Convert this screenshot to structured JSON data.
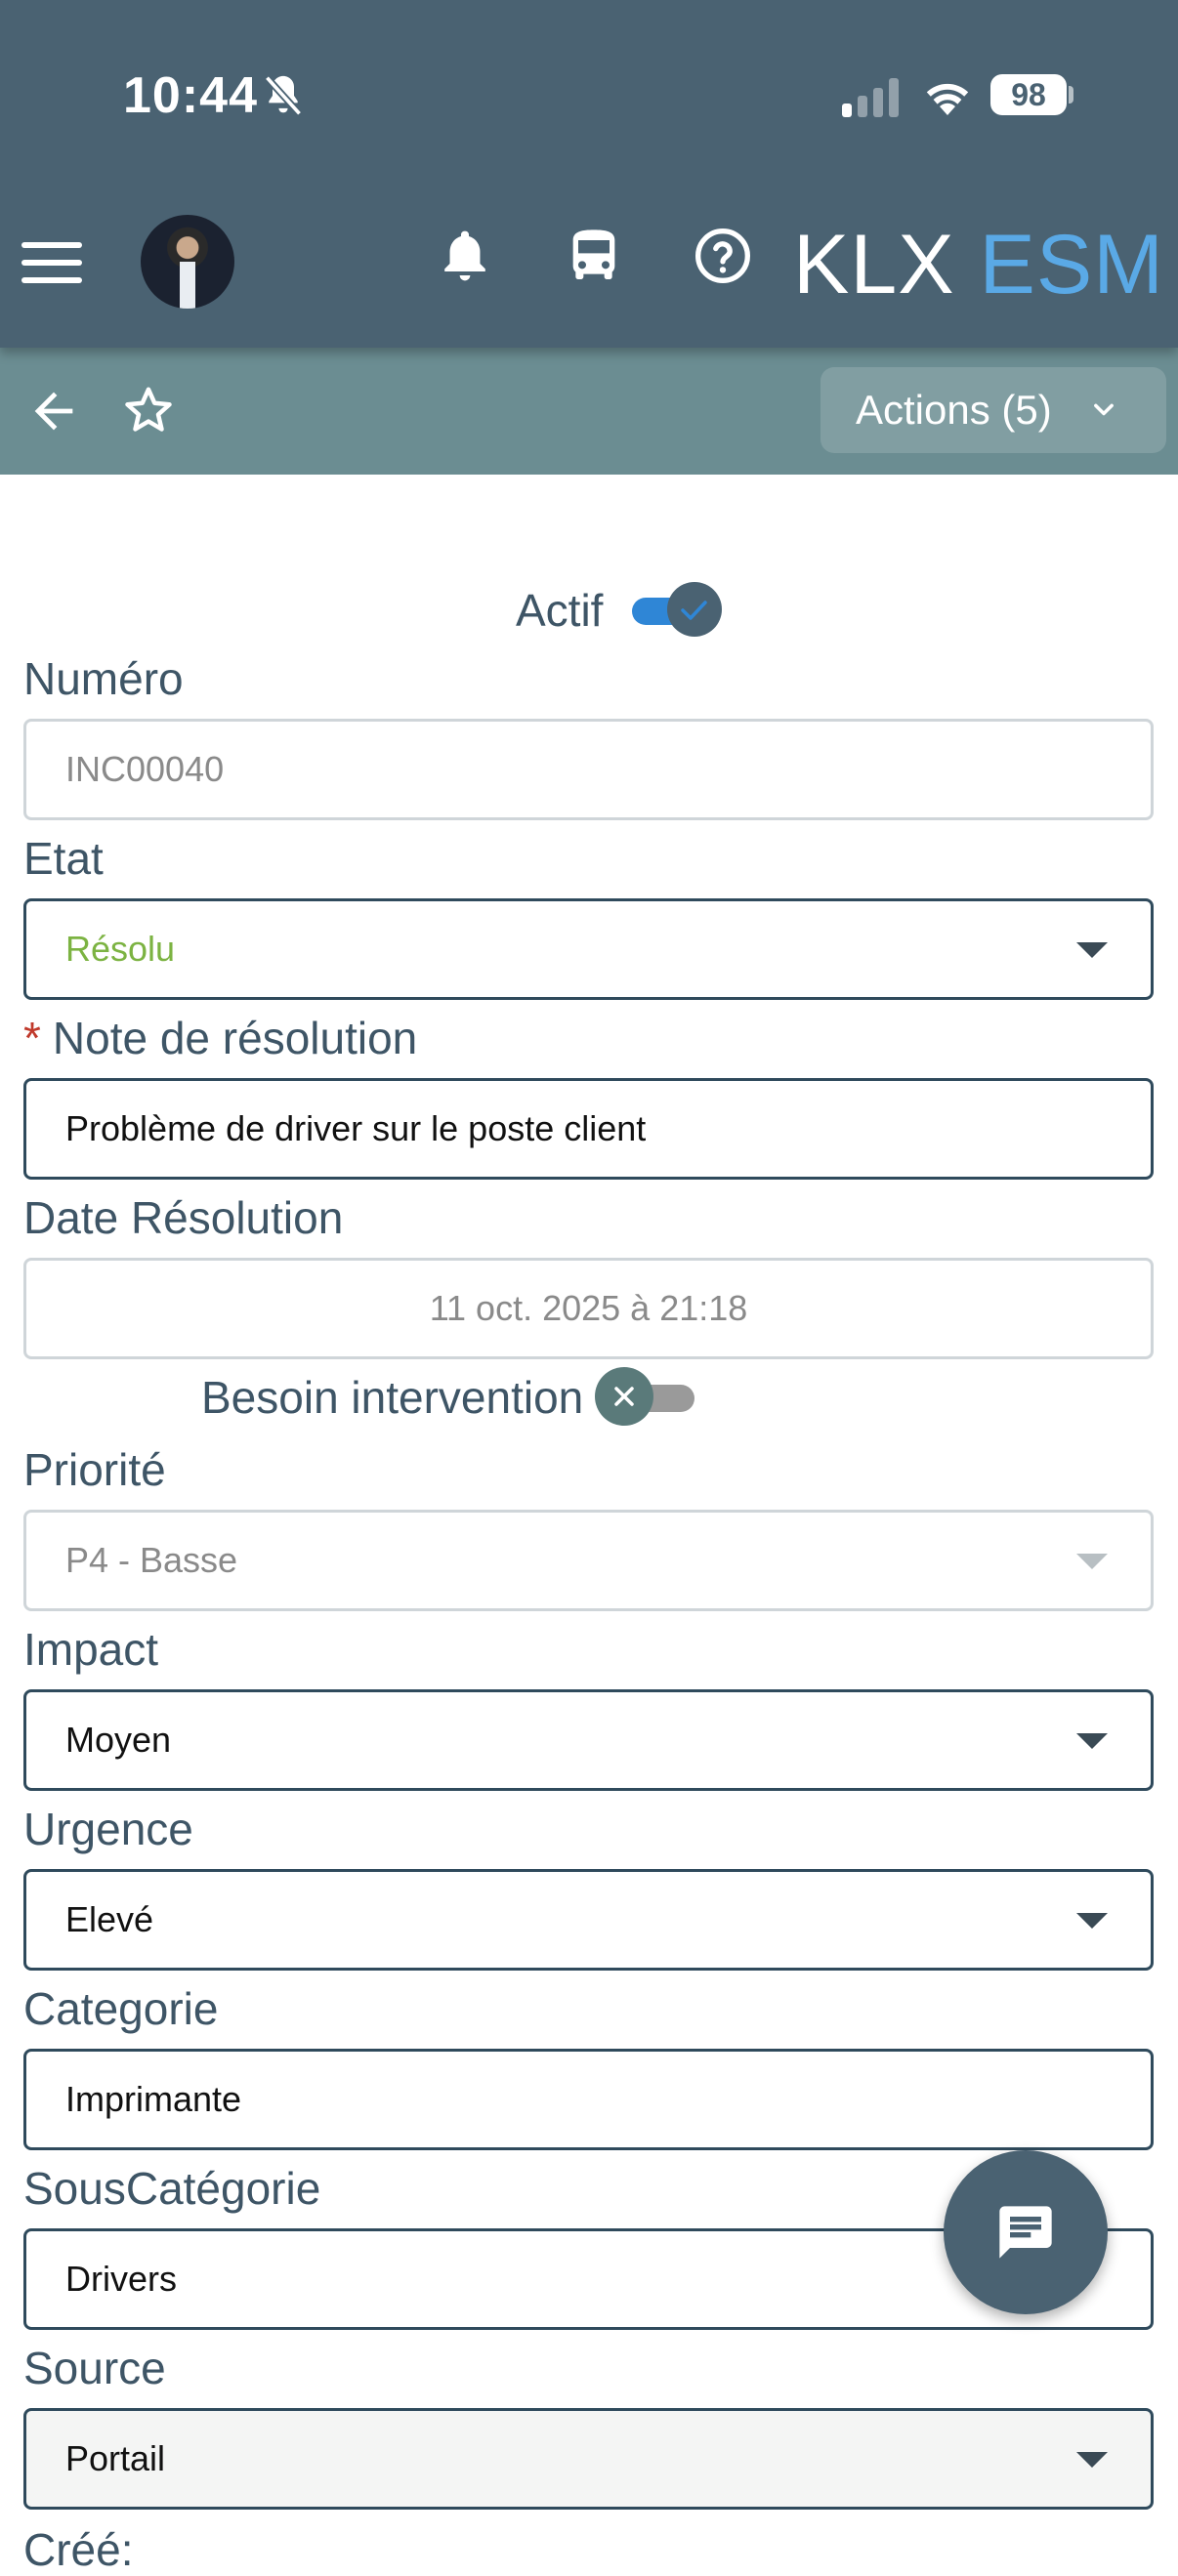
{
  "status_bar": {
    "time": "10:44",
    "battery": "98",
    "icons": [
      "bell-off-icon",
      "signal-icon",
      "wifi-icon",
      "battery-icon"
    ]
  },
  "header": {
    "brand_primary": "KLX",
    "brand_secondary": "ESM",
    "icons": [
      "menu-icon",
      "avatar",
      "bell-icon",
      "bus-icon",
      "help-icon"
    ],
    "colors": {
      "header_bg": "#4a6272",
      "actionbar_bg": "#6b8d92",
      "brand_accent": "#5aa9e6"
    }
  },
  "actionbar": {
    "actions_label": "Actions (5)",
    "icons": [
      "back-arrow-icon",
      "star-icon",
      "chevron-down-icon"
    ]
  },
  "form": {
    "actif": {
      "label": "Actif",
      "checked": true
    },
    "numero": {
      "label": "Numéro",
      "value": "INC00040"
    },
    "etat": {
      "label": "Etat",
      "value": "Résolu"
    },
    "note_resolution": {
      "label": "Note de résolution",
      "required_mark": "*",
      "value": "Problème de driver sur le poste client"
    },
    "date_resolution": {
      "label": "Date Résolution",
      "value": "11 oct. 2025 à 21:18"
    },
    "besoin_intervention": {
      "label": "Besoin intervention",
      "checked": false
    },
    "priorite": {
      "label": "Priorité",
      "value": "P4 - Basse"
    },
    "impact": {
      "label": "Impact",
      "value": "Moyen"
    },
    "urgence": {
      "label": "Urgence",
      "value": "Elevé"
    },
    "categorie": {
      "label": "Categorie",
      "value": "Imprimante"
    },
    "sous_categorie": {
      "label": "SousCatégorie",
      "value": "Drivers"
    },
    "source": {
      "label": "Source",
      "value": "Portail"
    },
    "cree": {
      "label": "Créé:"
    }
  },
  "fab": {
    "icon": "chat-icon"
  }
}
